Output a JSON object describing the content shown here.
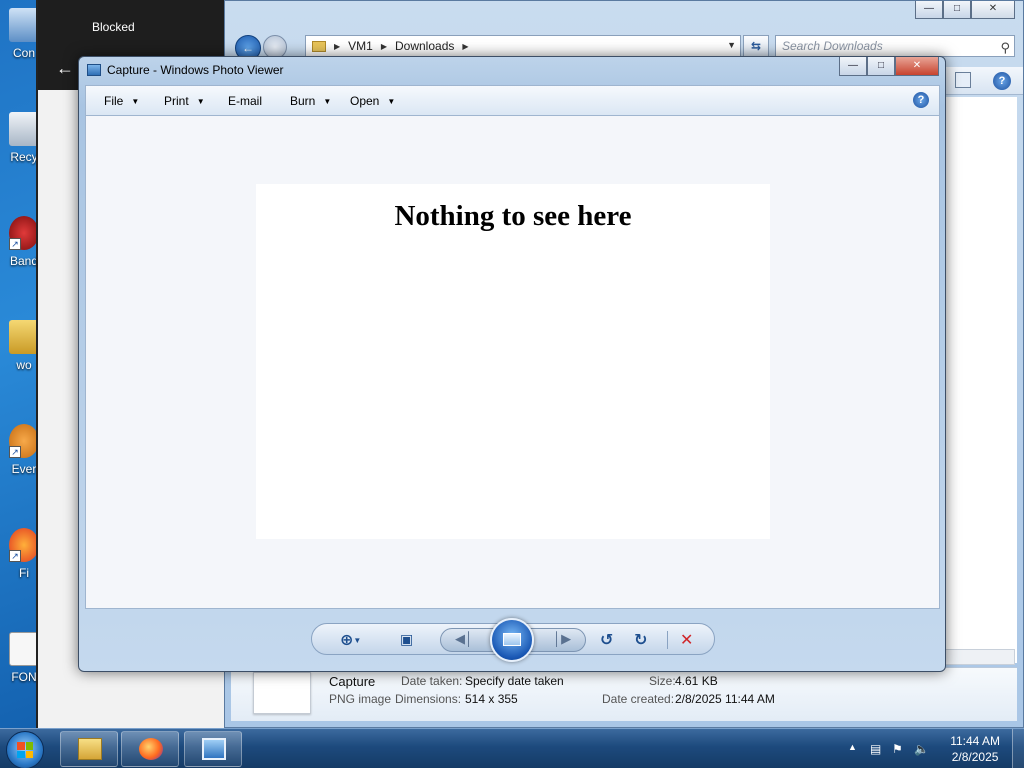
{
  "desktop": {
    "icons": [
      {
        "name": "desktop-icon-con",
        "label": "Con"
      },
      {
        "name": "desktop-icon-recycle",
        "label": "Recy"
      },
      {
        "name": "desktop-icon-band",
        "label": "Band"
      },
      {
        "name": "desktop-icon-wo",
        "label": "wo"
      },
      {
        "name": "desktop-icon-ever",
        "label": "Ever"
      },
      {
        "name": "desktop-icon-fi",
        "label": "Fi"
      },
      {
        "name": "desktop-icon-fon",
        "label": "FON"
      }
    ]
  },
  "blocked_window": {
    "title": "Blocked",
    "back_icon": "arrow-left-icon"
  },
  "explorer": {
    "address": {
      "segments": [
        "VM1",
        "Downloads"
      ]
    },
    "search_placeholder": "Search Downloads",
    "details": {
      "file_name": "Capture",
      "file_type": "PNG image",
      "date_taken_label": "Date taken:",
      "date_taken_value": "Specify date taken",
      "dimensions_label": "Dimensions:",
      "dimensions_value": "514 x 355",
      "size_label": "Size:",
      "size_value": "4.61 KB",
      "date_created_label": "Date created:",
      "date_created_value": "2/8/2025 11:44 AM"
    }
  },
  "viewer": {
    "title": "Capture - Windows Photo Viewer",
    "menu": [
      "File",
      "Print",
      "E-mail",
      "Burn",
      "Open"
    ],
    "photo_text": "Nothing to see here"
  },
  "taskbar": {
    "time": "11:44 AM",
    "date": "2/8/2025"
  },
  "colors": {
    "taskbar": "#1d4a7d",
    "accent": "#1856b3",
    "delete": "#d0262a"
  }
}
